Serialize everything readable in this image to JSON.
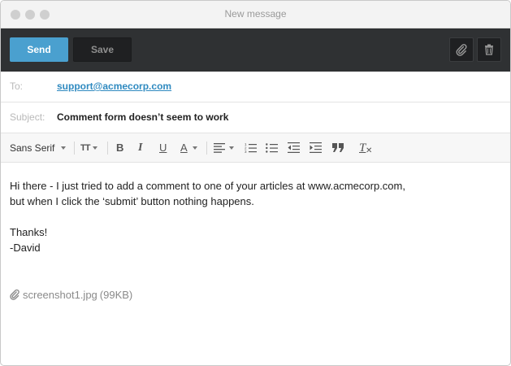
{
  "window": {
    "title": "New message"
  },
  "toolbar": {
    "send_label": "Send",
    "save_label": "Save"
  },
  "to": {
    "label": "To:",
    "value": "support@acmecorp.com"
  },
  "subject": {
    "label": "Subject:",
    "value": "Comment form doesn’t seem to work"
  },
  "format": {
    "font_family": "Sans Serif",
    "tools": [
      "font-size-icon",
      "bold-icon",
      "italic-icon",
      "underline-icon",
      "text-color-icon",
      "align-icon",
      "ordered-list-icon",
      "bullet-list-icon",
      "outdent-icon",
      "indent-icon",
      "blockquote-icon",
      "clear-format-icon"
    ],
    "bold_glyph": "B",
    "italic_glyph": "I",
    "underline_glyph": "U",
    "text_color_glyph": "A",
    "font_size_glyph": "TT",
    "clear_glyph": "T"
  },
  "body": {
    "line1": "Hi there - I just tried to add a comment to one of your articles at www.acmecorp.com,",
    "line2": "but when I click the ‘submit’ button nothing happens.",
    "line3": "Thanks!",
    "line4": "-David"
  },
  "attachment": {
    "filename": "screenshot1.jpg",
    "size": "(99KB)"
  },
  "colors": {
    "accent": "#4aa0cf",
    "toolbar_bg": "#2f3133",
    "link": "#2f8ac0"
  }
}
